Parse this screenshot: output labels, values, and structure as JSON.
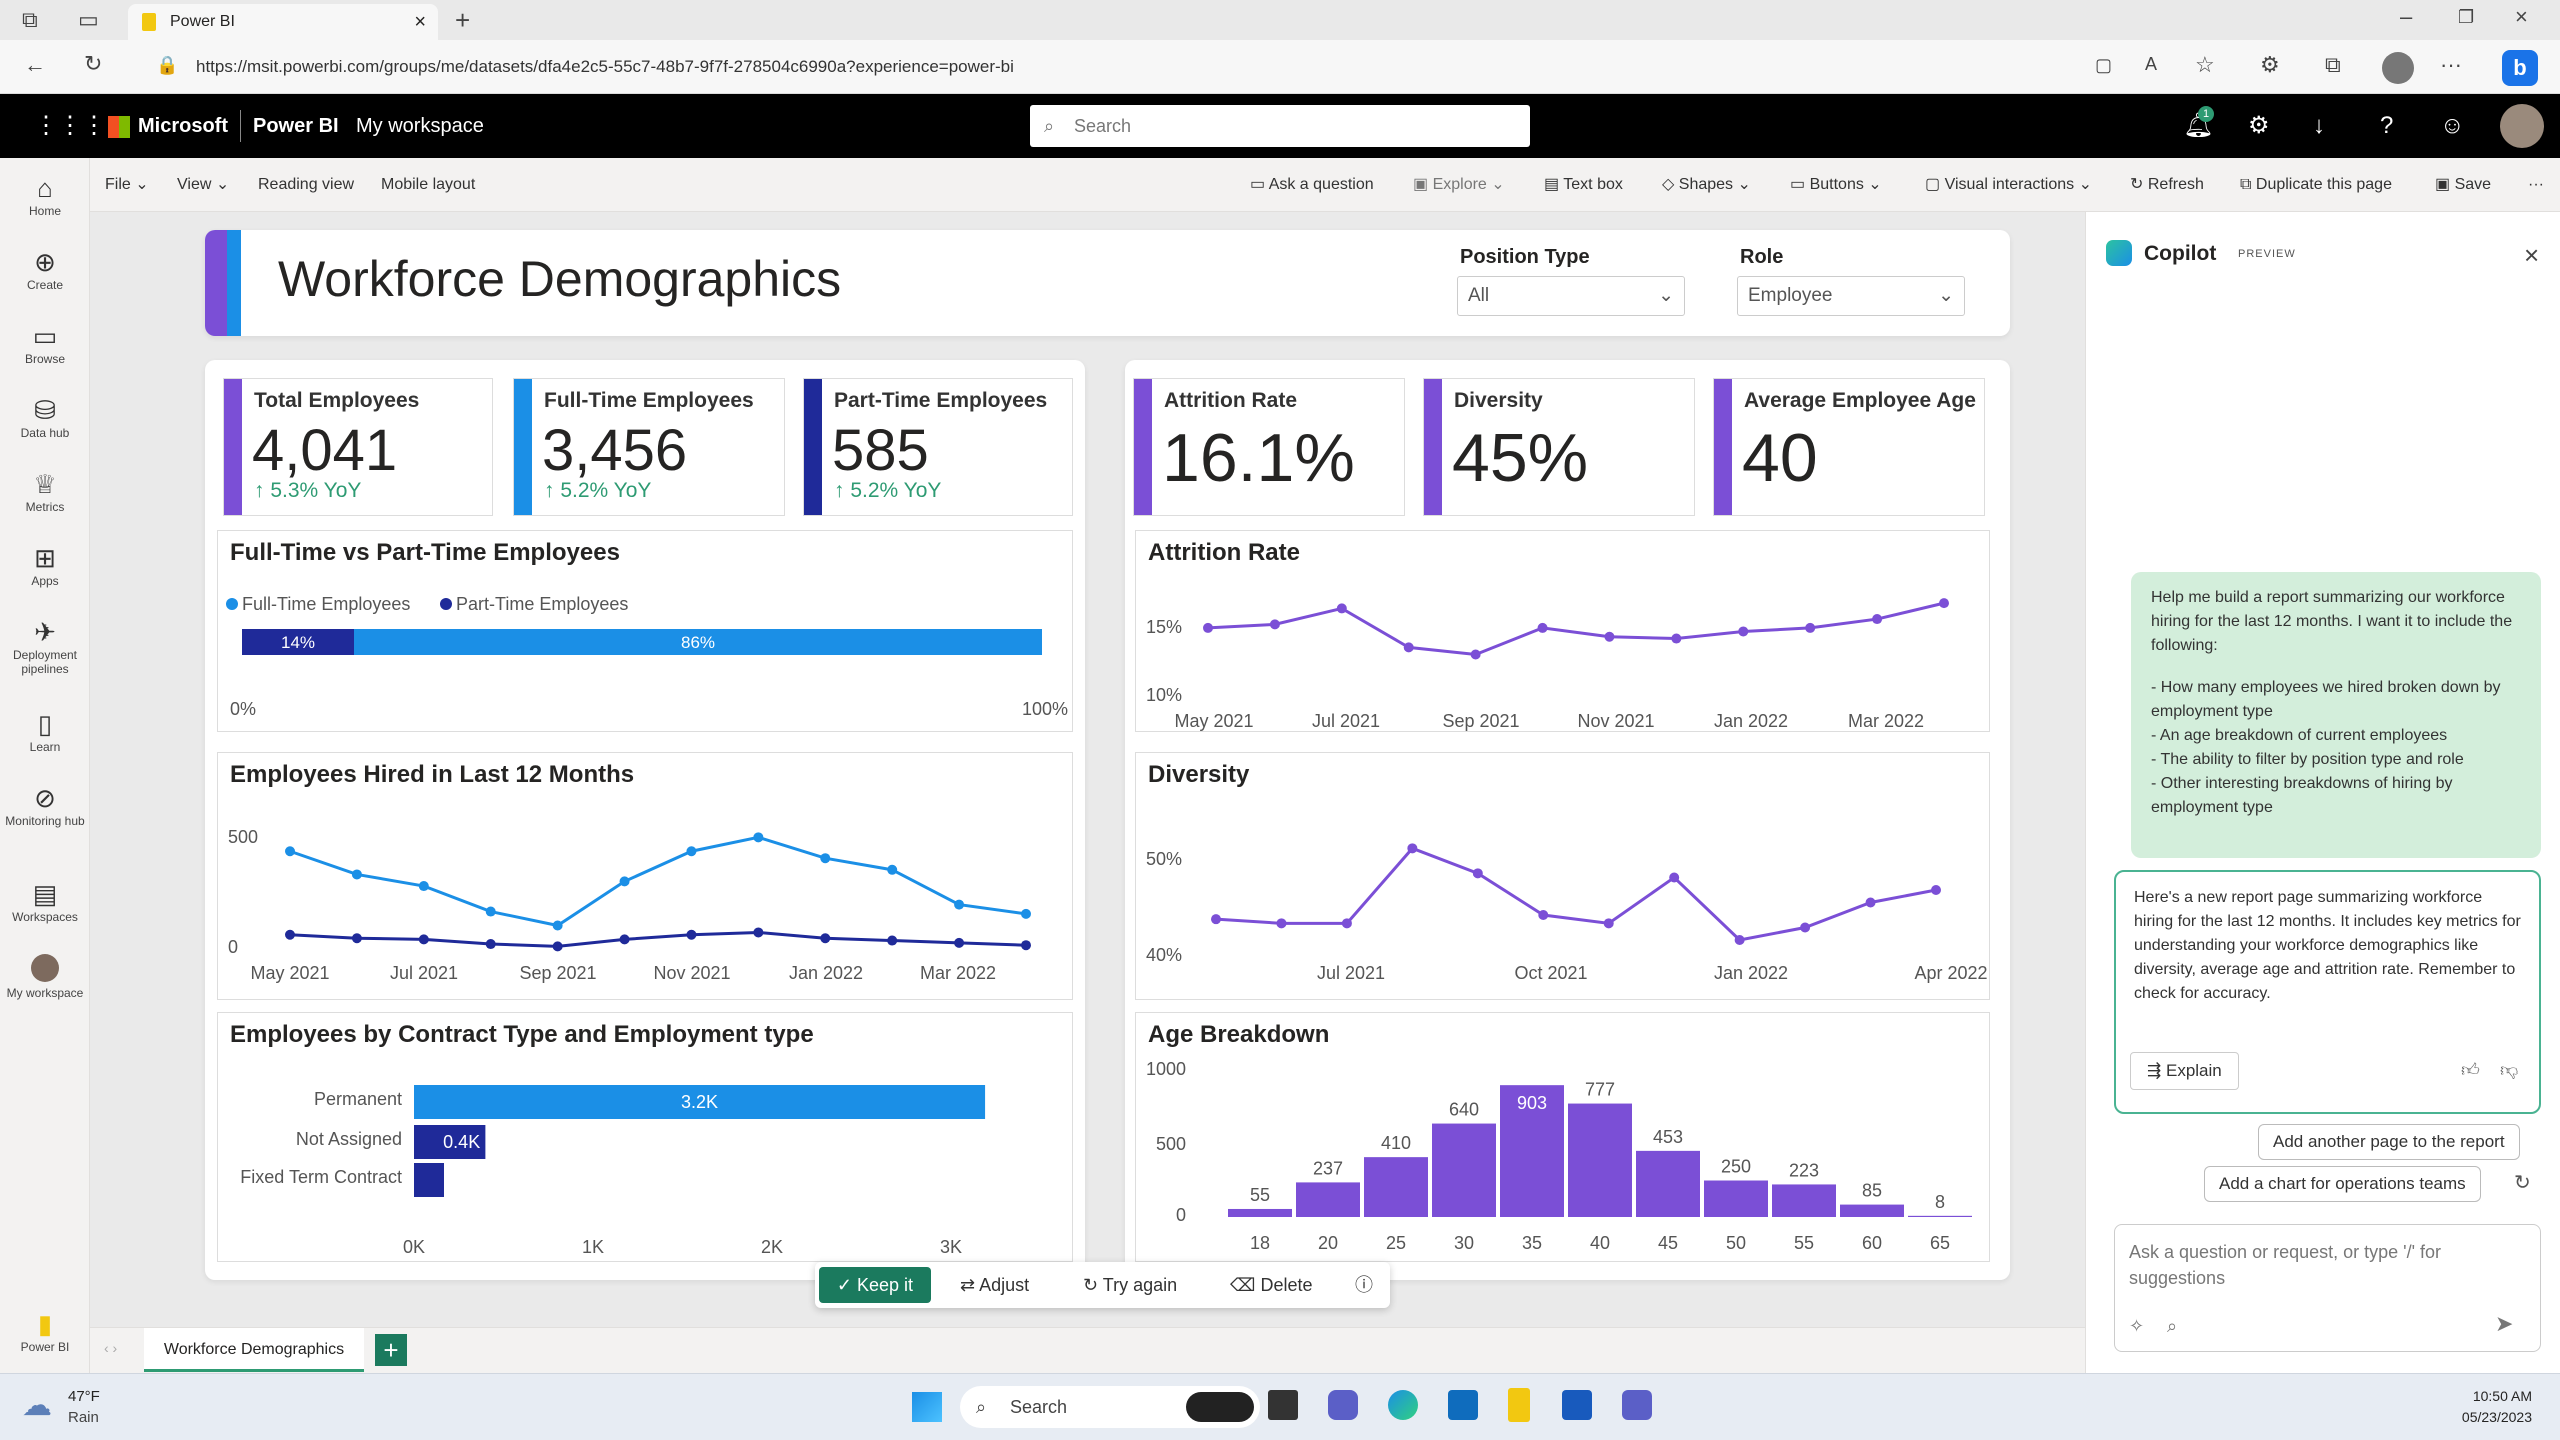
{
  "browser": {
    "tab_title": "Power BI",
    "url": "https://msit.powerbi.com/groups/me/datasets/dfa4e2c5-55c7-48b7-9f7f-278504c6990a?experience=power-bi"
  },
  "header": {
    "brand": "Microsoft",
    "product": "Power BI",
    "workspace": "My workspace",
    "search_placeholder": "Search",
    "notification_count": "1"
  },
  "leftnav": {
    "items": [
      "Home",
      "Create",
      "Browse",
      "Data hub",
      "Metrics",
      "Apps",
      "Deployment pipelines",
      "Learn",
      "Monitoring hub",
      "Workspaces",
      "My workspace"
    ],
    "bottom": "Power BI"
  },
  "ribbon": {
    "left": [
      "File",
      "View",
      "Reading view",
      "Mobile layout"
    ],
    "right": [
      "Ask a question",
      "Explore",
      "Text box",
      "Shapes",
      "Buttons",
      "Visual interactions",
      "Refresh",
      "Duplicate this page",
      "Save"
    ]
  },
  "report": {
    "title": "Workforce Demographics",
    "filters": [
      {
        "label": "Position Type",
        "value": "All"
      },
      {
        "label": "Role",
        "value": "Employee"
      }
    ],
    "kpis": [
      {
        "label": "Total Employees",
        "value": "4,041",
        "yoy": "↑ 5.3% YoY",
        "color": "#7b4fd6"
      },
      {
        "label": "Full-Time Employees",
        "value": "3,456",
        "yoy": "↑ 5.2% YoY",
        "color": "#1b8fe6"
      },
      {
        "label": "Part-Time Employees",
        "value": "585",
        "yoy": "↑ 5.2% YoY",
        "color": "#1f2a99"
      },
      {
        "label": "Attrition Rate",
        "value": "16.1%",
        "color": "#7b4fd6"
      },
      {
        "label": "Diversity",
        "value": "45%",
        "color": "#7b4fd6"
      },
      {
        "label": "Average Employee Age",
        "value": "40",
        "color": "#7b4fd6"
      }
    ]
  },
  "chart_data": [
    {
      "type": "bar",
      "title": "Full-Time vs Part-Time Employees",
      "legend": [
        "Full-Time Employees",
        "Part-Time Employees"
      ],
      "series": [
        {
          "name": "Part-Time Employees",
          "values": [
            14
          ]
        },
        {
          "name": "Full-Time Employees",
          "values": [
            86
          ]
        }
      ],
      "labels": [
        "14%",
        "86%"
      ],
      "xticks": [
        "0%",
        "100%"
      ],
      "colors": [
        "#1f2a99",
        "#1b8fe6"
      ]
    },
    {
      "type": "line",
      "title": "Employees Hired in Last 12 Months",
      "xticks": [
        "May 2021",
        "Jul 2021",
        "Sep 2021",
        "Nov 2021",
        "Jan 2022",
        "Mar 2022"
      ],
      "yticks": [
        "500",
        "0"
      ],
      "ylim": [
        0,
        500
      ],
      "series": [
        {
          "values": [
            430,
            330,
            280,
            170,
            110,
            300,
            430,
            490,
            400,
            350,
            200,
            160
          ],
          "color": "#1b8fe6"
        },
        {
          "values": [
            70,
            55,
            50,
            30,
            20,
            50,
            70,
            80,
            55,
            45,
            35,
            25
          ],
          "color": "#1f2a99"
        }
      ]
    },
    {
      "type": "bar",
      "title": "Employees by Contract Type and Employment type",
      "categories": [
        "Permanent",
        "Not Assigned",
        "Fixed Term Contract"
      ],
      "values": [
        3200,
        400,
        100
      ],
      "labels": [
        "3.2K",
        "0.4K",
        ""
      ],
      "xticks": [
        "0K",
        "1K",
        "2K",
        "3K"
      ],
      "colors": [
        "#1b8fe6",
        "#1f2a99",
        "#1f2a99"
      ]
    },
    {
      "type": "line",
      "title": "Attrition Rate",
      "xticks": [
        "May 2021",
        "Jul 2021",
        "Sep 2021",
        "Nov 2021",
        "Jan 2022",
        "Mar 2022"
      ],
      "yticks": [
        "15%",
        "10%"
      ],
      "ylim": [
        10,
        17
      ],
      "values": [
        13.9,
        14.1,
        15.0,
        12.8,
        12.4,
        13.9,
        13.4,
        13.3,
        13.7,
        13.9,
        14.4,
        15.3
      ],
      "color": "#7b4fd6"
    },
    {
      "type": "line",
      "title": "Diversity",
      "xticks": [
        "Jul 2021",
        "Oct 2021",
        "Jan 2022",
        "Apr 2022"
      ],
      "yticks": [
        "50%",
        "40%"
      ],
      "ylim": [
        38,
        56
      ],
      "values": [
        43.5,
        43,
        43,
        52,
        49,
        44,
        43,
        48.5,
        41,
        42.5,
        45.5,
        47
      ],
      "color": "#7b4fd6"
    },
    {
      "type": "bar",
      "title": "Age Breakdown",
      "categories": [
        "18",
        "20",
        "25",
        "30",
        "35",
        "40",
        "45",
        "50",
        "55",
        "60",
        "65"
      ],
      "values": [
        55,
        237,
        410,
        640,
        903,
        777,
        453,
        250,
        223,
        85,
        8
      ],
      "yticks": [
        "1000",
        "500",
        "0"
      ],
      "ylim": [
        0,
        1000
      ],
      "color": "#7b4fd6"
    }
  ],
  "copilot": {
    "title": "Copilot",
    "badge": "PREVIEW",
    "user_msg": "Help me build a report summarizing our workforce hiring for the last 12 months. I want it to include the following:",
    "user_bullets": [
      "- How many employees we hired broken down by employment type",
      "- An age breakdown of current employees",
      "- The ability to filter by position type and role",
      "- Other interesting breakdowns of hiring by employment type"
    ],
    "reply": "Here's a new report page summarizing workforce hiring for the last 12 months. It includes key metrics for understanding your workforce demographics like diversity, average age and attrition rate. Remember to check for accuracy.",
    "explain": "Explain",
    "suggestions": [
      "Add another page to the report",
      "Add a chart for operations teams"
    ],
    "input_placeholder": "Ask a question or request, or type '/' for suggestions"
  },
  "actions": [
    "Keep it",
    "Adjust",
    "Try again",
    "Delete"
  ],
  "pagetab": "Workforce Demographics",
  "taskbar": {
    "weather_temp": "47°F",
    "weather_desc": "Rain",
    "search": "Search",
    "time": "10:50 AM",
    "date": "05/23/2023"
  }
}
